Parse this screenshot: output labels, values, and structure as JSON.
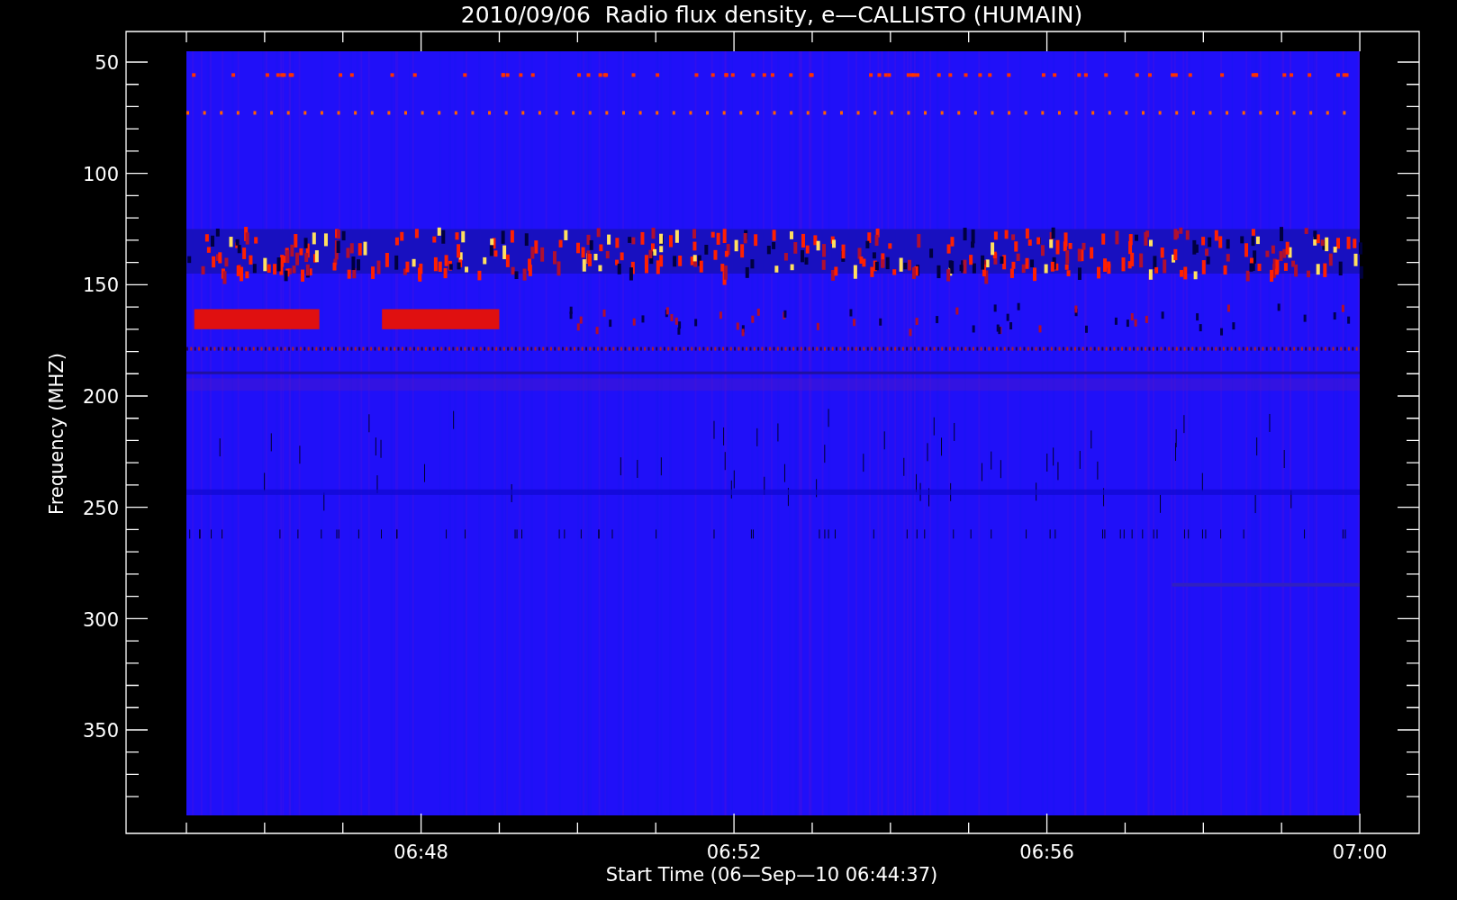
{
  "title": "2010/09/06  Radio flux density, e—CALLISTO (HUMAIN)",
  "y_axis": {
    "label": "Frequency (MHZ)",
    "ticks": [
      "50",
      "100",
      "150",
      "200",
      "250",
      "300",
      "350"
    ]
  },
  "x_axis": {
    "label": "Start Time (06—Sep—10 06:44:37)",
    "ticks": [
      "06:48",
      "06:52",
      "06:56",
      "07:00"
    ]
  }
}
